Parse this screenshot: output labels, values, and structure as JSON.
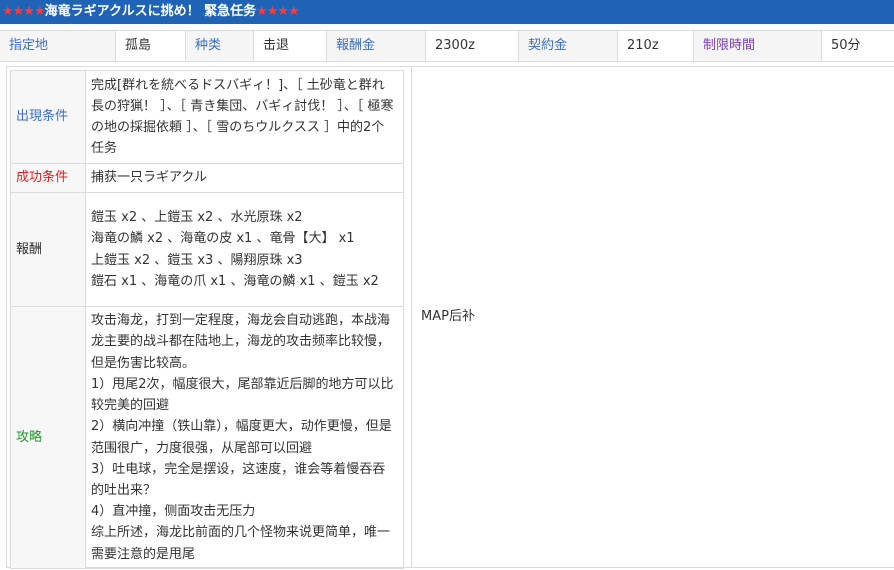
{
  "title": {
    "stars_left": "★★★★",
    "text": "海竜ラギアクルスに挑め！ 緊急任务",
    "stars_right": "★★★★"
  },
  "info": {
    "location_label": "指定地",
    "location_value": "孤島",
    "type_label": "种类",
    "type_value": "击退",
    "reward_money_label": "報酬金",
    "reward_money_value": "2300z",
    "contract_label": "契約金",
    "contract_value": "210z",
    "time_limit_label": "制限時間",
    "time_limit_value": "50分"
  },
  "details": {
    "appear_label": "出現条件",
    "appear_text": "完成[群れを統べるドスバギィ！]、［ 土砂竜と群れ長の狩猟！ ］、［ 青き集団、バギィ討伐！ ］、［ 極寒の地の採掘依頼 ］、［ 雪のちウルクスス ］中的2个任务",
    "success_label": "成功条件",
    "success_text": "捕获一只ラギアクル",
    "reward_label": "報酬",
    "reward_lines": [
      "鎧玉 x2 、上鎧玉 x2 、水光原珠 x2",
      "海竜の鱗 x2 、海竜の皮 x1 、竜骨【大】 x1",
      "上鎧玉 x2 、鎧玉 x3 、陽翔原珠 x3",
      "鎧石 x1 、海竜の爪 x1 、海竜の鱗 x1 、鎧玉 x2"
    ],
    "strategy_label": "攻略",
    "strategy_lines": [
      "攻击海龙，打到一定程度，海龙会自动逃跑，本战海龙主要的战斗都在陆地上，海龙的攻击频率比较慢，但是伤害比较高。",
      "1）甩尾2次，幅度很大，尾部靠近后脚的地方可以比较完美的回避",
      "2）横向冲撞（铁山靠），幅度更大，动作更慢，但是范围很广，力度很强，从尾部可以回避",
      "3）吐电球，完全是摆设，这速度，谁会等着慢吞吞的吐出来？",
      "4）直冲撞，侧面攻击无压力",
      "综上所述，海龙比前面的几个怪物来说更简单，唯一需要注意的是甩尾"
    ],
    "map_text": "MAP后补"
  }
}
